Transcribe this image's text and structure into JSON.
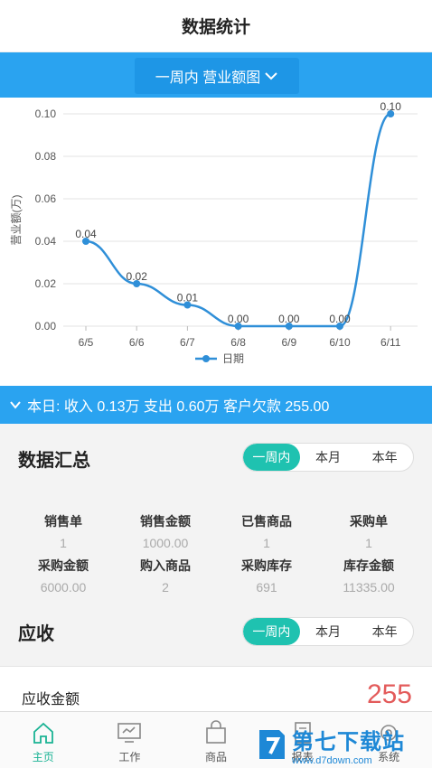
{
  "header": {
    "title": "数据统计"
  },
  "period_selector": {
    "label": "一周内 营业额图"
  },
  "chart_data": {
    "type": "line",
    "categories": [
      "6/5",
      "6/6",
      "6/7",
      "6/8",
      "6/9",
      "6/10",
      "6/11"
    ],
    "series": [
      {
        "name": "日期",
        "values": [
          0.04,
          0.02,
          0.01,
          0.0,
          0.0,
          0.0,
          0.1
        ]
      }
    ],
    "data_labels": [
      "0.04",
      "0.02",
      "0.01",
      "0.00",
      "0.00",
      "0.00",
      "0.10"
    ],
    "ylabel": "营业额(万)",
    "ylim": [
      0,
      0.1
    ],
    "yticks": [
      "0.00",
      "0.02",
      "0.04",
      "0.06",
      "0.08",
      "0.10"
    ],
    "grid": true,
    "legend": "bottom",
    "line_color": "#2f8fd8"
  },
  "day_summary": {
    "text": "本日: 收入 0.13万 支出 0.60万 客户欠款 255.00"
  },
  "summary": {
    "title": "数据汇总",
    "segments": [
      "一周内",
      "本月",
      "本年"
    ],
    "stats": [
      {
        "label": "销售单",
        "value": "1"
      },
      {
        "label": "销售金额",
        "value": "1000.00"
      },
      {
        "label": "已售商品",
        "value": "1"
      },
      {
        "label": "采购单",
        "value": "1"
      },
      {
        "label": "采购金额",
        "value": "6000.00"
      },
      {
        "label": "购入商品",
        "value": "2"
      },
      {
        "label": "采购库存",
        "value": "691"
      },
      {
        "label": "库存金额",
        "value": "11335.00"
      }
    ]
  },
  "receivable": {
    "title": "应收",
    "segments": [
      "一周内",
      "本月",
      "本年"
    ],
    "label": "应收金额",
    "amount": "255"
  },
  "tabbar": {
    "items": [
      {
        "label": "主页",
        "icon": "home-icon",
        "active": true
      },
      {
        "label": "工作",
        "icon": "monitor-icon",
        "active": false
      },
      {
        "label": "商品",
        "icon": "bag-icon",
        "active": false
      },
      {
        "label": "报表",
        "icon": "report-icon",
        "active": false
      },
      {
        "label": "系统",
        "icon": "settings-icon",
        "active": false
      }
    ]
  },
  "watermark": {
    "name": "第七下载站",
    "url": "www.d7down.com"
  },
  "colors": {
    "accent": "#2aa3f0",
    "active_segment": "#1fc2b0",
    "amount": "#e35b5b",
    "tab_active": "#1ab394"
  }
}
